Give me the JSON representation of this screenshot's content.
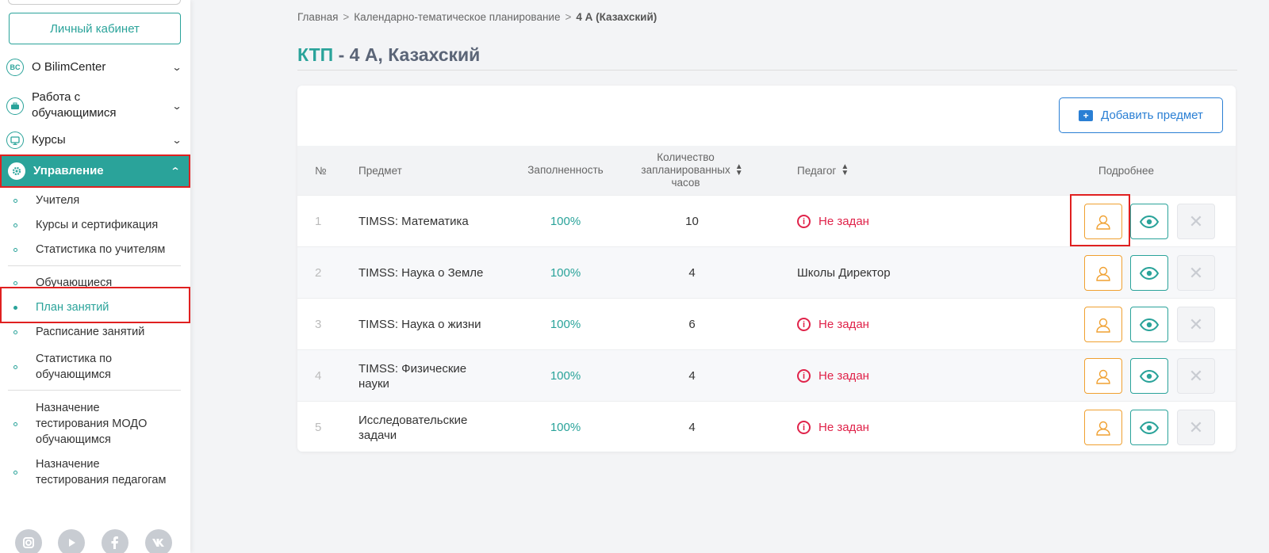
{
  "sidebar": {
    "cabinet_label": "Личный кабинет",
    "menu": [
      {
        "label": "О BilimCenter",
        "icon": "bc-logo-icon",
        "icon_text": "BC"
      },
      {
        "label_line1": "Работа с",
        "label_line2": "обучающимися",
        "icon": "briefcase-icon"
      },
      {
        "label": "Курсы",
        "icon": "monitor-icon"
      },
      {
        "label": "Управление",
        "icon": "gear-icon"
      }
    ],
    "sub_items": [
      {
        "label": "Учителя"
      },
      {
        "label": "Курсы и сертификация"
      },
      {
        "label": "Статистика по учителям"
      },
      {
        "label": "Обучающиеся"
      },
      {
        "label": "План занятий"
      },
      {
        "label": "Расписание занятий"
      },
      {
        "label_line1": "Статистика по",
        "label_line2": "обучающимся"
      },
      {
        "label_line1": "Назначение",
        "label_line2": "тестирования МОДО",
        "label_line3": "обучающимся"
      },
      {
        "label_line1": "Назначение",
        "label_line2": "тестирования педагогам"
      }
    ],
    "social": [
      "instagram-icon",
      "youtube-icon",
      "facebook-icon",
      "vk-icon"
    ]
  },
  "breadcrumb": {
    "home": "Главная",
    "section": "Календарно-тематическое планирование",
    "current": "4 А (Казахский)"
  },
  "page": {
    "title_accent": "КТП",
    "title_rest": " - 4 А, Казахский"
  },
  "toolbar": {
    "add_subject_label": "Добавить предмет"
  },
  "table": {
    "headers": {
      "num": "№",
      "subject": "Предмет",
      "fill": "Заполненность",
      "hours_line1": "Количество",
      "hours_line2": "запланированных",
      "hours_line3": "часов",
      "teacher": "Педагог",
      "details": "Подробнее"
    },
    "rows": [
      {
        "num": "1",
        "subject_line1": "TIMSS: Математика",
        "subject_line2": "",
        "fill": "100%",
        "hours": "10",
        "teacher": "Не задан",
        "teacher_set": false
      },
      {
        "num": "2",
        "subject_line1": "TIMSS: Наука о Земле",
        "subject_line2": "",
        "fill": "100%",
        "hours": "4",
        "teacher": "Школы Директор",
        "teacher_set": true
      },
      {
        "num": "3",
        "subject_line1": "TIMSS: Наука о жизни",
        "subject_line2": "",
        "fill": "100%",
        "hours": "6",
        "teacher": "Не задан",
        "teacher_set": false
      },
      {
        "num": "4",
        "subject_line1": "TIMSS: Физические",
        "subject_line2": "науки",
        "fill": "100%",
        "hours": "4",
        "teacher": "Не задан",
        "teacher_set": false
      },
      {
        "num": "5",
        "subject_line1": "Исследовательские",
        "subject_line2": "задачи",
        "fill": "100%",
        "hours": "4",
        "teacher": "Не задан",
        "teacher_set": false
      }
    ]
  },
  "colors": {
    "accent": "#2aa39a",
    "link": "#2a7fd4",
    "warning": "#e0234a",
    "user_btn": "#f0a030",
    "highlight": "#e02020"
  }
}
